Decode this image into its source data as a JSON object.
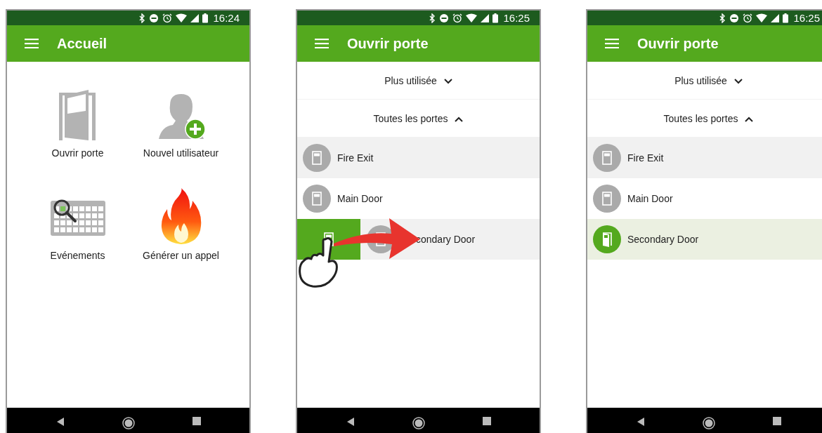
{
  "phones": [
    {
      "kind": "home",
      "status_time": "16:24",
      "title": "Accueil",
      "tiles": [
        {
          "kind": "door",
          "label": "Ouvrir porte"
        },
        {
          "kind": "user_add",
          "label": "Nouvel utilisateur"
        },
        {
          "kind": "calendar",
          "label": "Evénements"
        },
        {
          "kind": "fire",
          "label": "Générer un appel"
        }
      ]
    },
    {
      "kind": "door_list",
      "status_time": "16:25",
      "title": "Ouvrir porte",
      "swipe_hint": true,
      "sections": [
        {
          "label": "Plus utilisée",
          "expanded": false
        },
        {
          "label": "Toutes les portes",
          "expanded": true
        }
      ],
      "doors": [
        {
          "name": "Fire Exit",
          "kind": "closed",
          "highlighted": true
        },
        {
          "name": "Main Door",
          "kind": "closed",
          "highlighted": false
        },
        {
          "name": "condary Door",
          "kind": "swiping",
          "highlighted": true
        }
      ]
    },
    {
      "kind": "door_list",
      "status_time": "16:25",
      "title": "Ouvrir porte",
      "sections": [
        {
          "label": "Plus utilisée",
          "expanded": false
        },
        {
          "label": "Toutes les portes",
          "expanded": true
        }
      ],
      "doors": [
        {
          "name": "Fire Exit",
          "kind": "closed",
          "highlighted": true
        },
        {
          "name": "Main Door",
          "kind": "closed",
          "highlighted": false
        },
        {
          "name": "Secondary Door",
          "kind": "open",
          "highlighted": false
        }
      ]
    }
  ]
}
